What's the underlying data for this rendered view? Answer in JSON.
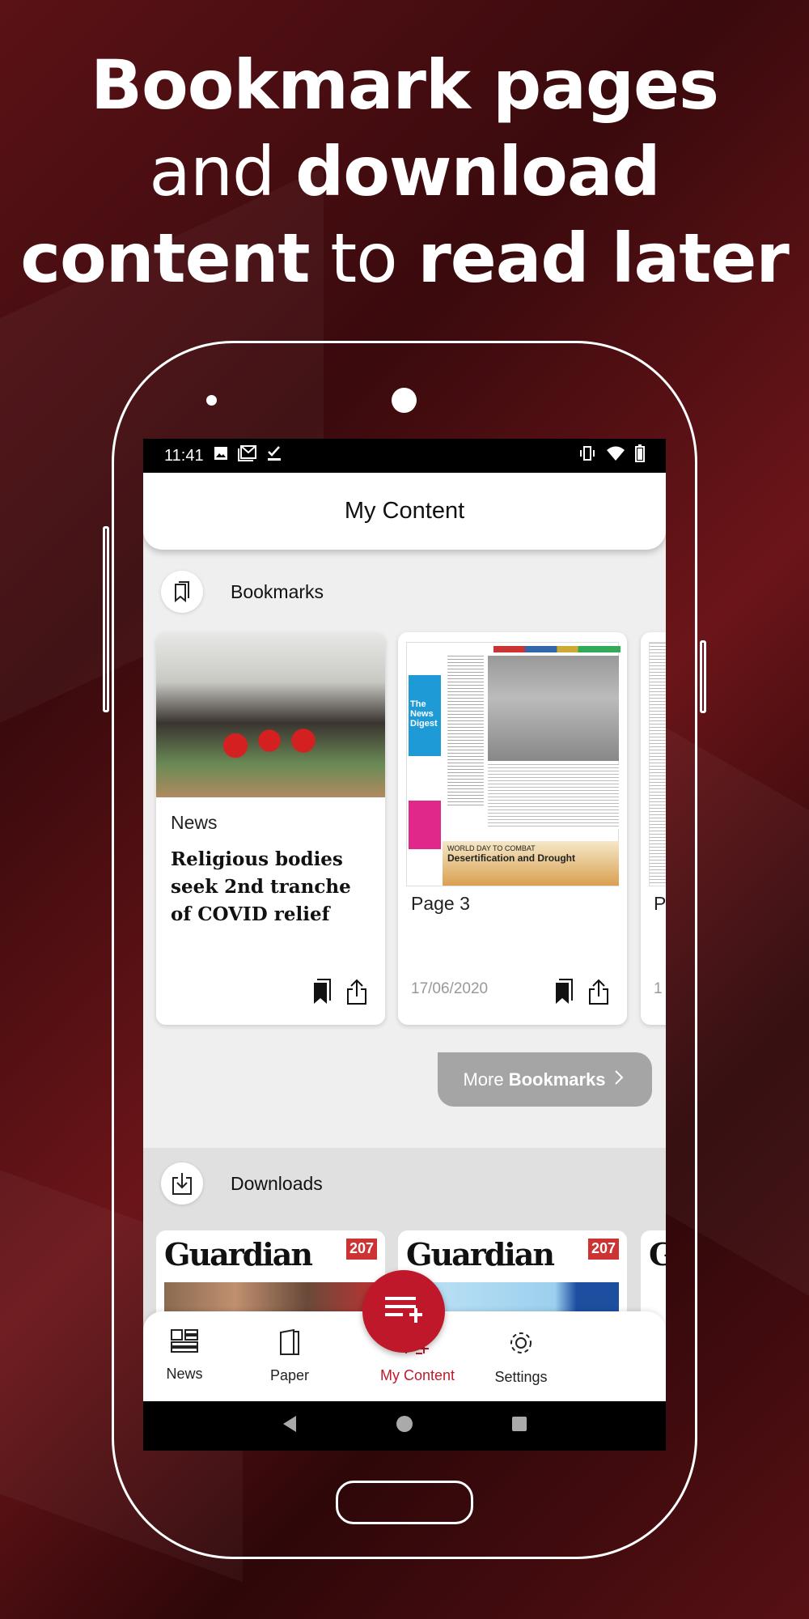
{
  "promo": {
    "line1_bold": "Bookmark pages",
    "line2_light": "and ",
    "line2_bold": "download",
    "line3_bold1": "content",
    "line3_light": " to ",
    "line3_bold2": "read later"
  },
  "status_bar": {
    "time": "11:41",
    "icons": [
      "image-icon",
      "gmail-icon",
      "check-icon",
      "vibrate-icon",
      "wifi-icon",
      "battery-icon"
    ]
  },
  "header": {
    "title": "My Content"
  },
  "bookmarks": {
    "label": "Bookmarks",
    "cards": [
      {
        "category": "News",
        "title": "Religious bodies seek 2nd tranche of COVID relief"
      },
      {
        "title": "Page 3",
        "date": "17/06/2020",
        "paper_caption": "WORLD DAY TO COMBAT",
        "paper_headline": "Desertification and Drought",
        "paper_digest": "The News Digest"
      },
      {
        "title": "P",
        "date": "1"
      }
    ],
    "more_light": "More ",
    "more_bold": "Bookmarks"
  },
  "downloads": {
    "label": "Downloads",
    "cards": [
      {
        "masthead": "Guardian",
        "count": "207"
      },
      {
        "masthead": "Guardian",
        "count": "207"
      },
      {
        "masthead": "G"
      }
    ]
  },
  "bottom_nav": {
    "items": [
      {
        "label": "News"
      },
      {
        "label": "Paper"
      },
      {
        "label": "My Content",
        "active": true
      },
      {
        "label": "Settings"
      }
    ]
  },
  "colors": {
    "accent": "#c0182b",
    "more_button": "#a5a5a5",
    "background": "#4a0e11"
  }
}
